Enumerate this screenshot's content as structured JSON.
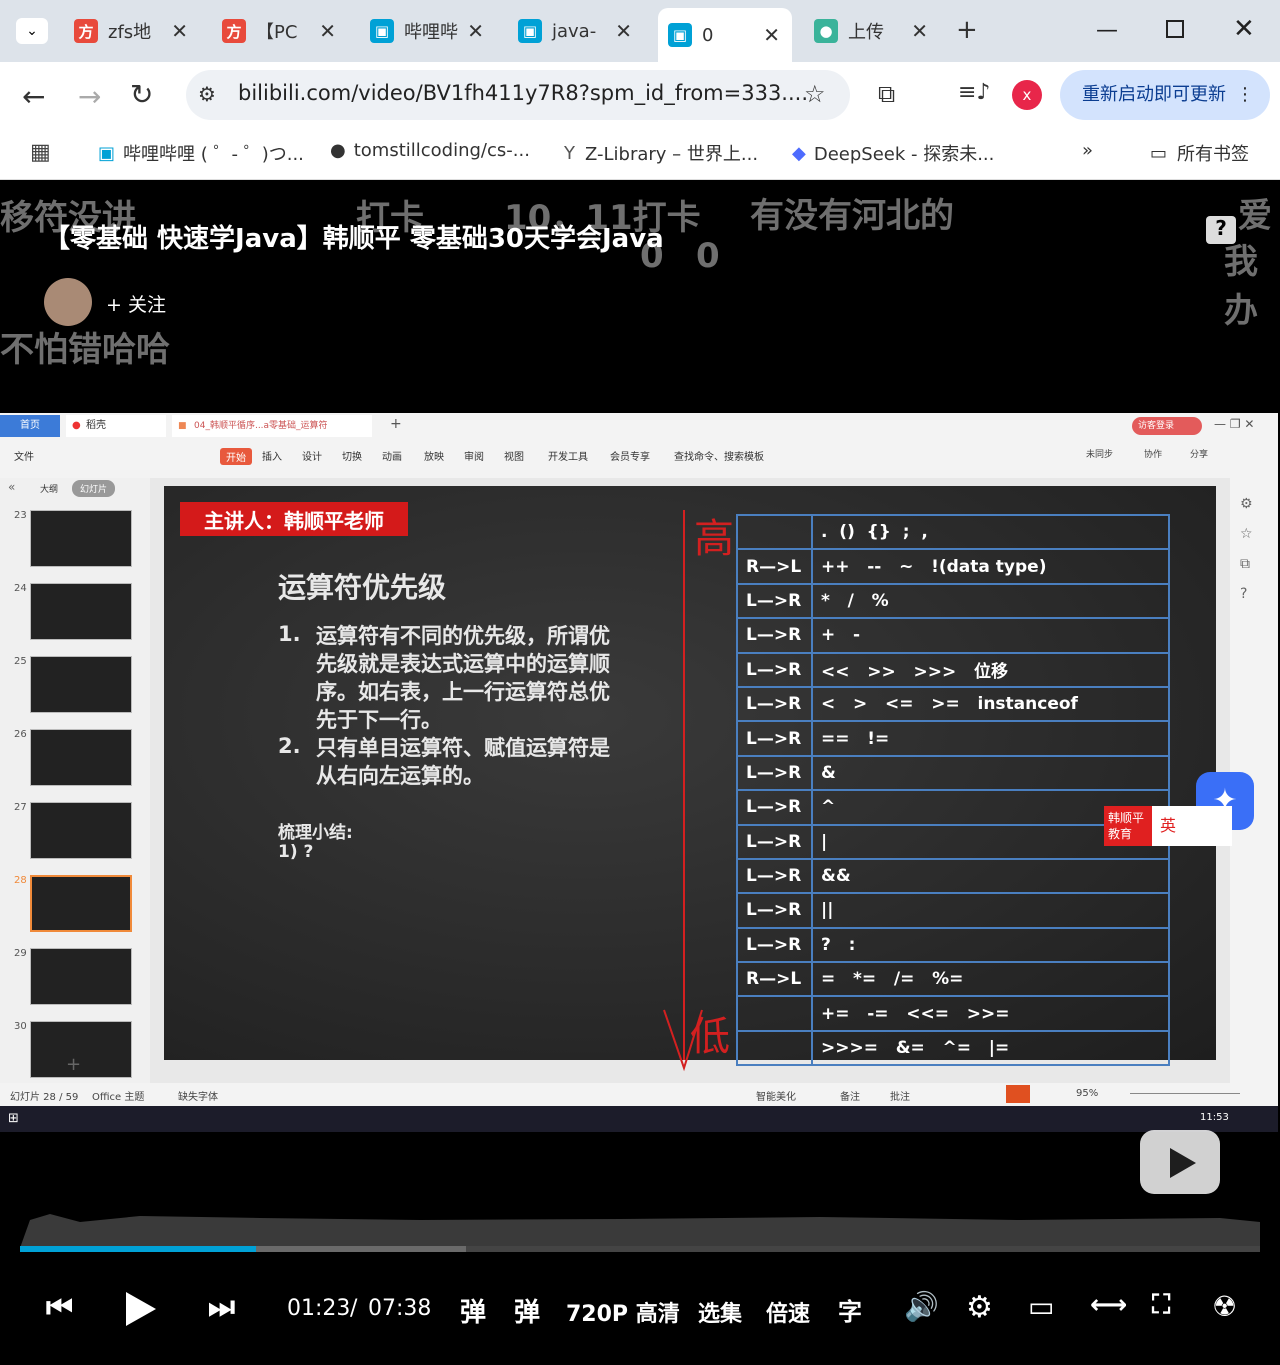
{
  "browser": {
    "tabs": [
      {
        "label": "zfs地",
        "icon": "fang-icon"
      },
      {
        "label": "【PC",
        "icon": "fang-icon"
      },
      {
        "label": "哔哩哔",
        "icon": "bilibili-icon"
      },
      {
        "label": "java-",
        "icon": "bilibili-icon"
      },
      {
        "label": "0",
        "icon": "bilibili-icon"
      },
      {
        "label": "上传",
        "icon": "app-icon"
      }
    ],
    "url": "bilibili.com/video/BV1fh411y7R8?spm_id_from=333....",
    "profile_initial": "x",
    "update_label": "重新启动即可更新",
    "bookmarks": [
      "哔哩哔哩 ( ゜- ゜)つ...",
      "tomstillcoding/cs-...",
      "Z-Library – 世界上...",
      "DeepSeek - 探索未..."
    ],
    "all_bookmarks": "所有书签",
    "more": "»"
  },
  "video": {
    "title": "【零基础 快速学Java】韩顺平 零基础30天学会Java",
    "follow": "+ 关注",
    "danmaku": [
      "移符没讲",
      "打卡",
      "10，11打卡",
      "有没有河北的",
      "爱",
      "我办",
      "不怕错哈哈",
      "0",
      "0"
    ],
    "time_current": "01:23",
    "time_sep": "/",
    "time_total": "07:38",
    "quality": "720P 高清",
    "episodes": "选集",
    "speed": "倍速",
    "progress": 0.19,
    "buffered": 0.36
  },
  "wps": {
    "tabs": [
      "首页",
      "稻壳",
      "04_韩顺平循序...a零基础_运算符"
    ],
    "login": "访客登录",
    "menus": [
      "文件",
      "开始",
      "插入",
      "设计",
      "切换",
      "动画",
      "放映",
      "审阅",
      "视图",
      "开发工具",
      "会员专享",
      "查找命令、搜索模板"
    ],
    "right_menus": [
      "未同步",
      "协作",
      "分享"
    ],
    "view_tabs": [
      "大纲",
      "幻灯片"
    ],
    "thumb_numbers": [
      "23",
      "24",
      "25",
      "26",
      "27",
      "28",
      "29",
      "30"
    ],
    "status_slide": "幻灯片 28 / 59",
    "status_theme": "Office 主题",
    "status_font": "缺失字体",
    "status_right": [
      "智能美化",
      "备注",
      "批注"
    ],
    "zoom": "95%",
    "ime_brand": "韩顺平教育",
    "ime_lang": "英",
    "clock": "11:53"
  },
  "slide": {
    "presenter": "主讲人：韩顺平老师",
    "heading": "运算符优先级",
    "point1_num": "1.",
    "point1": "运算符有不同的优先级，所谓优先级就是表达式运算中的运算顺序。如右表，上一行运算符总优先于下一行。",
    "point2_num": "2.",
    "point2": "只有单目运算符、赋值运算符是从右向左运算的。",
    "summary": "梳理小结:",
    "summary_item": "1) ?",
    "annot_high": "高",
    "annot_low": "低",
    "table": [
      [
        "",
        ".  ()  {}  ;  ,"
      ],
      [
        "R—>L",
        "++   --   ~   !(data type)"
      ],
      [
        "L—>R",
        "*   /   %"
      ],
      [
        "L—>R",
        "+   -"
      ],
      [
        "L—>R",
        "<<   >>   >>>   位移"
      ],
      [
        "L—>R",
        "<   >   <=   >=   instanceof"
      ],
      [
        "L—>R",
        "==   !="
      ],
      [
        "L—>R",
        "&"
      ],
      [
        "L—>R",
        "^"
      ],
      [
        "L—>R",
        "|"
      ],
      [
        "L—>R",
        "&&"
      ],
      [
        "L—>R",
        "||"
      ],
      [
        "L—>R",
        "?   :"
      ],
      [
        "R—>L",
        "=   *=   /=   %="
      ],
      [
        "",
        "+=   -=   <<=   >>="
      ],
      [
        "",
        ">>>=   &=   ^=   |="
      ]
    ]
  }
}
